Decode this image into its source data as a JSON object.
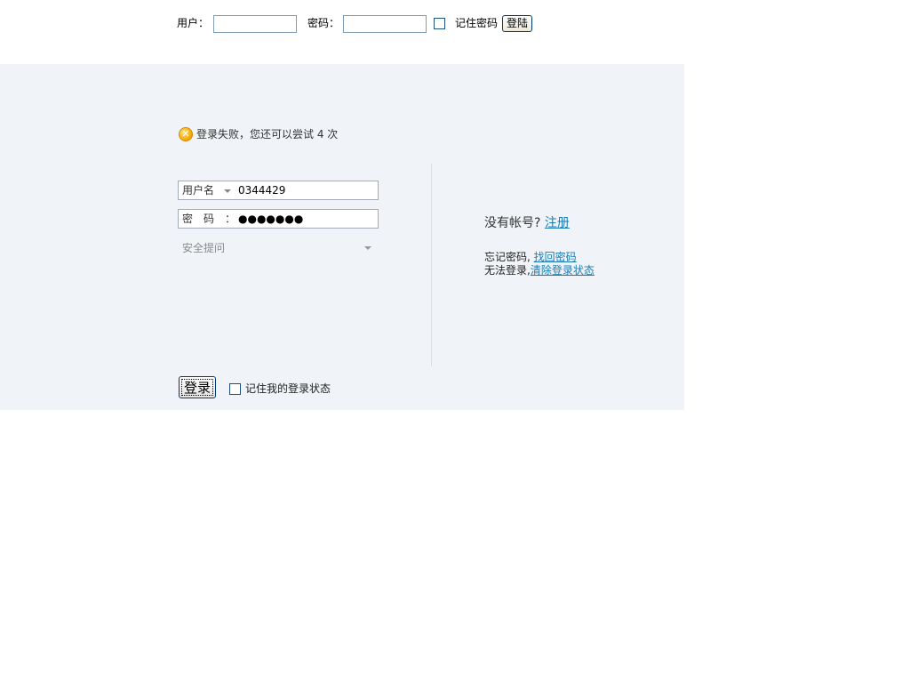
{
  "topbar": {
    "user_label": "用户：",
    "password_label": "密码：",
    "remember_label": "记住密码",
    "login_button": "登陆"
  },
  "login": {
    "error_icon": "error-x-icon",
    "error_message": "登录失败，您还可以尝试 4 次",
    "username_label": "用户名",
    "username_value": "0344429",
    "password_label": "密　码　：",
    "password_value": "●●●●●●●",
    "security_question": "安全提问",
    "submit_button": "登录",
    "remember_state_label": "记住我的登录状态"
  },
  "side": {
    "no_account_text": "没有帐号?",
    "register_link": "注册",
    "forgot_text": "忘记密码,",
    "recover_link": "找回密码",
    "cannot_login_text": "无法登录,",
    "clear_link": "清除登录状态"
  },
  "colors": {
    "panel_bg": "#f0f3f7",
    "link": "#1a7cb2",
    "error_icon": "#f5a500"
  }
}
